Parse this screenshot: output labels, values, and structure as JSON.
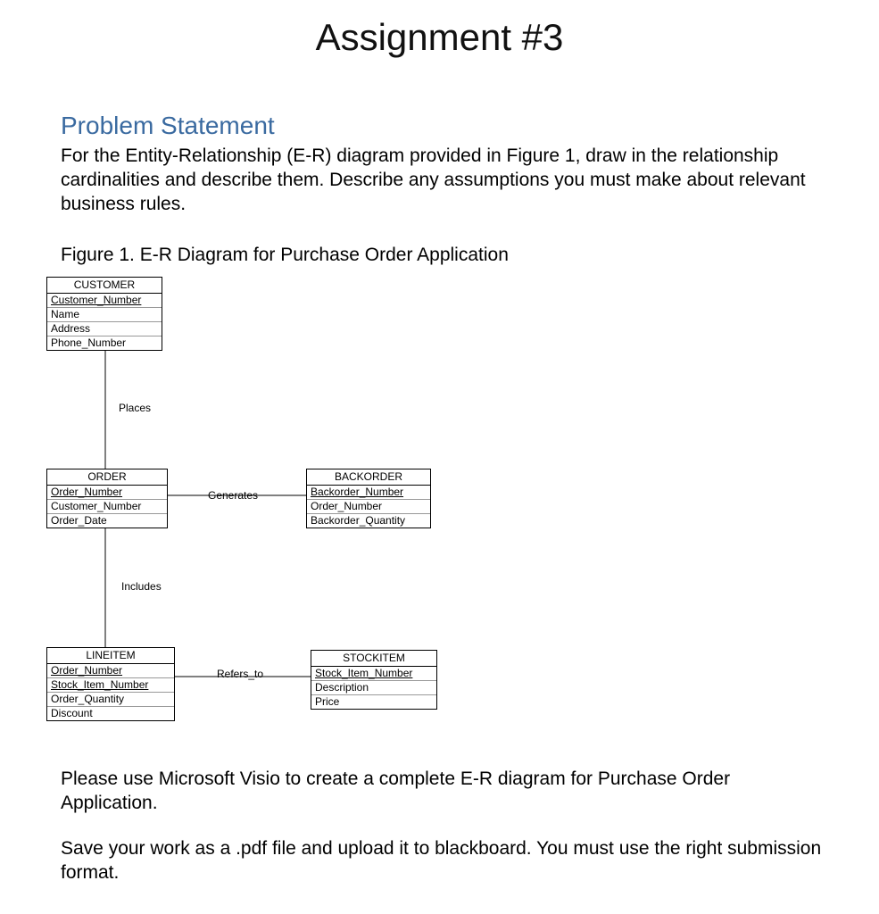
{
  "document": {
    "title": "Assignment #3",
    "section_heading": "Problem Statement",
    "problem_text": "For the Entity-Relationship (E-R) diagram provided in Figure 1, draw in the relationship cardinalities and describe them. Describe any assumptions you must make about relevant business rules.",
    "figure_caption": "Figure 1. E-R Diagram for Purchase Order Application",
    "instruction_1": "Please use Microsoft Visio to create a complete E-R diagram for Purchase Order Application.",
    "instruction_2": "Save your work as a .pdf file and upload it to blackboard. You must use the right submission format."
  },
  "diagram": {
    "entities": {
      "customer": {
        "name": "CUSTOMER",
        "attrs": [
          "Customer_Number",
          "Name",
          "Address",
          "Phone_Number"
        ],
        "pk": [
          0
        ]
      },
      "order": {
        "name": "ORDER",
        "attrs": [
          "Order_Number",
          "Customer_Number",
          "Order_Date"
        ],
        "pk": [
          0
        ]
      },
      "backorder": {
        "name": "BACKORDER",
        "attrs": [
          "Backorder_Number",
          "Order_Number",
          "Backorder_Quantity"
        ],
        "pk": [
          0
        ]
      },
      "lineitem": {
        "name": "LINEITEM",
        "attrs": [
          "Order_Number",
          "Stock_Item_Number",
          "Order_Quantity",
          "Discount"
        ],
        "pk": [
          0,
          1
        ]
      },
      "stockitem": {
        "name": "STOCKITEM",
        "attrs": [
          "Stock_Item_Number",
          "Description",
          "Price"
        ],
        "pk": [
          0
        ]
      }
    },
    "relationships": {
      "places": "Places",
      "generates": "Generates",
      "includes": "Includes",
      "refers_to": "Refers_to"
    }
  }
}
